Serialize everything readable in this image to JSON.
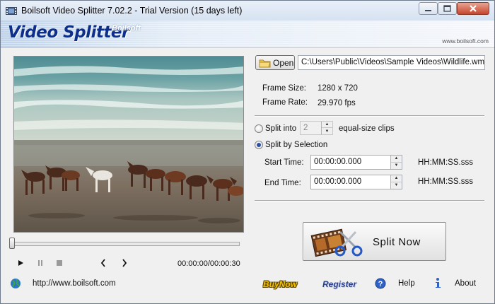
{
  "window": {
    "title": "Boilsoft Video Splitter 7.02.2 - Trial Version (15 days left)"
  },
  "banner": {
    "logo_text": "Video Splitter",
    "brand": "Boilsoft",
    "website": "www.boilsoft.com"
  },
  "player": {
    "time_readout": "00:00:00/00:00:30",
    "position_fraction": 0.0
  },
  "file": {
    "open_label": "Open",
    "path": "C:\\Users\\Public\\Videos\\Sample Videos\\Wildlife.wmv"
  },
  "info": {
    "frame_size_label": "Frame Size:",
    "frame_size_value": "1280 x 720",
    "frame_rate_label": "Frame Rate:",
    "frame_rate_value": "29.970 fps"
  },
  "split_options": {
    "split_into_label": "Split into",
    "clips_count": "2",
    "clips_suffix": "equal-size clips",
    "split_by_selection_label": "Split by Selection",
    "selected": "split_by_selection",
    "start_time_label": "Start Time:",
    "start_time_value": "00:00:00.000",
    "end_time_label": "End Time:",
    "end_time_value": "00:00:00.000",
    "time_format": "HH:MM:SS.sss"
  },
  "split_button": {
    "label": "Split Now"
  },
  "footer": {
    "url": "http://www.boilsoft.com",
    "buy_now": "BuyNow",
    "register": "Register",
    "help": "Help",
    "about": "About"
  },
  "colors": {
    "logo": "#0d2f8a",
    "buy_now": "#f2c200",
    "register": "#2b3f8a"
  }
}
